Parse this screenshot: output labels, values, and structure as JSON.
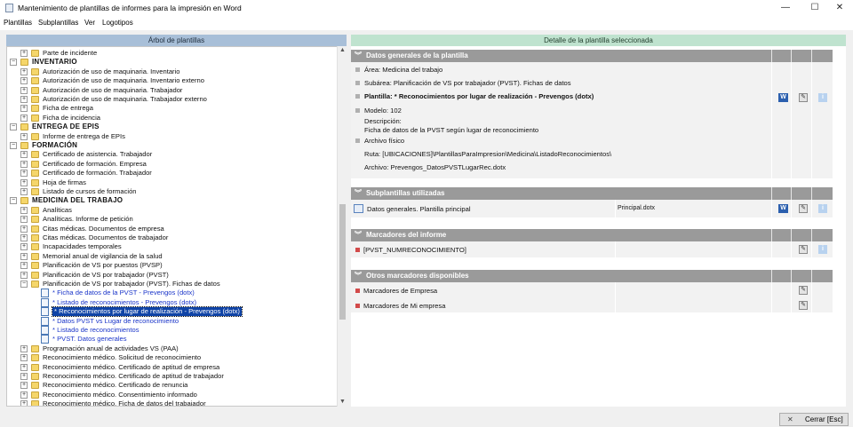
{
  "window": {
    "title": "Mantenimiento de plantillas de informes para la impresión en Word",
    "minimize": "—",
    "maximize": "☐",
    "close": "✕"
  },
  "menu": [
    "Plantillas",
    "Subplantillas",
    "Ver",
    "Logotipos"
  ],
  "left_panel": {
    "header": "Árbol de plantillas",
    "tree": [
      {
        "label": "Parte de incidente",
        "kind": "folder"
      },
      {
        "label": "INVENTARIO",
        "kind": "category"
      },
      {
        "label": "Autorización de uso de maquinaria. Inventario",
        "kind": "folder"
      },
      {
        "label": "Autorización de uso de maquinaria. Inventario externo",
        "kind": "folder"
      },
      {
        "label": "Autorización de uso de maquinaria. Trabajador",
        "kind": "folder"
      },
      {
        "label": "Autorización de uso de maquinaria. Trabajador externo",
        "kind": "folder"
      },
      {
        "label": "Ficha de entrega",
        "kind": "folder"
      },
      {
        "label": "Ficha de incidencia",
        "kind": "folder"
      },
      {
        "label": "ENTREGA DE EPIS",
        "kind": "category"
      },
      {
        "label": "Informe de entrega de EPIs",
        "kind": "folder"
      },
      {
        "label": "FORMACIÓN",
        "kind": "category"
      },
      {
        "label": "Certificado de asistencia. Trabajador",
        "kind": "folder"
      },
      {
        "label": "Certificado de formación. Empresa",
        "kind": "folder"
      },
      {
        "label": "Certificado de formación. Trabajador",
        "kind": "folder"
      },
      {
        "label": "Hoja de firmas",
        "kind": "folder"
      },
      {
        "label": "Listado de cursos de formación",
        "kind": "folder"
      },
      {
        "label": "MEDICINA DEL TRABAJO",
        "kind": "category"
      },
      {
        "label": "Analíticas",
        "kind": "folder"
      },
      {
        "label": "Analíticas. Informe de petición",
        "kind": "folder"
      },
      {
        "label": "Citas médicas. Documentos de empresa",
        "kind": "folder"
      },
      {
        "label": "Citas médicas. Documentos de trabajador",
        "kind": "folder"
      },
      {
        "label": "Incapacidades temporales",
        "kind": "folder"
      },
      {
        "label": "Memorial anual de vigilancia de la salud",
        "kind": "folder"
      },
      {
        "label": "Planificación de VS por puestos (PVSP)",
        "kind": "folder"
      },
      {
        "label": "Planificación de VS por trabajador (PVST)",
        "kind": "folder"
      },
      {
        "label": "Planificación de VS por trabajador (PVST). Fichas de datos",
        "kind": "folder-open"
      },
      {
        "label": "* Ficha de datos de la PVST - Prevengos (dotx)",
        "kind": "template"
      },
      {
        "label": "* Listado de reconocimientos - Prevengos (dotx)",
        "kind": "template"
      },
      {
        "label": "* Reconocimientos por lugar de realización - Prevengos (dotx)",
        "kind": "template-selected"
      },
      {
        "label": "* Datos PVST vs Lugar de reconocimiento",
        "kind": "template"
      },
      {
        "label": "* Listado de reconocimientos",
        "kind": "template"
      },
      {
        "label": "* PVST. Datos generales",
        "kind": "template"
      },
      {
        "label": "Programación anual de actividades VS (PAA)",
        "kind": "folder"
      },
      {
        "label": "Reconocimiento médico. Solicitud de reconocimiento",
        "kind": "folder"
      },
      {
        "label": "Reconocimiento médico. Certificado de aptitud de empresa",
        "kind": "folder"
      },
      {
        "label": "Reconocimiento médico. Certificado de aptitud de trabajador",
        "kind": "folder"
      },
      {
        "label": "Reconocimiento médico. Certificado de renuncia",
        "kind": "folder"
      },
      {
        "label": "Reconocimiento médico. Consentimiento informado",
        "kind": "folder"
      },
      {
        "label": "Reconocimiento médico. Ficha de datos del trabajador",
        "kind": "folder"
      }
    ],
    "scroll_up": "▲",
    "scroll_down": "▼"
  },
  "right_panel": {
    "header": "Detalle de la plantilla seleccionada",
    "general": {
      "title": "Datos generales de la plantilla",
      "area": "Área: Medicina del trabajo",
      "subarea": "Subárea: Planificación de VS por trabajador (PVST). Fichas de datos",
      "plantilla": "Plantilla: * Reconocimientos por lugar de realización - Prevengos (dotx)",
      "modelo": "Modelo: 102",
      "descripcion_label": "Descripción:",
      "descripcion": "Ficha de datos de la PVST según lugar de reconocimiento",
      "archivo_fisico": "Archivo físico",
      "ruta": "Ruta: [UBICACIONES]\\PlantillasParaImpresion\\Medicina\\ListadoReconocimientos\\",
      "archivo": "Archivo: Prevengos_DatosPVSTLugarRec.dotx"
    },
    "subplantillas": {
      "title": "Subplantillas utilizadas",
      "rows": [
        {
          "name": "Datos generales. Plantilla principal",
          "file": "Principal.dotx"
        }
      ]
    },
    "marcadores": {
      "title": "Marcadores del informe",
      "rows": [
        "[PVST_NUMRECONOCIMIENTO]"
      ]
    },
    "otros": {
      "title": "Otros marcadores disponibles",
      "rows": [
        "Marcadores de Empresa",
        "Marcadores de Mi empresa"
      ]
    },
    "icons": {
      "word": "W",
      "edit": "✎",
      "info": "i"
    }
  },
  "footer": {
    "close_label": "Cerrar  [Esc]",
    "close_glyph": "✕"
  }
}
